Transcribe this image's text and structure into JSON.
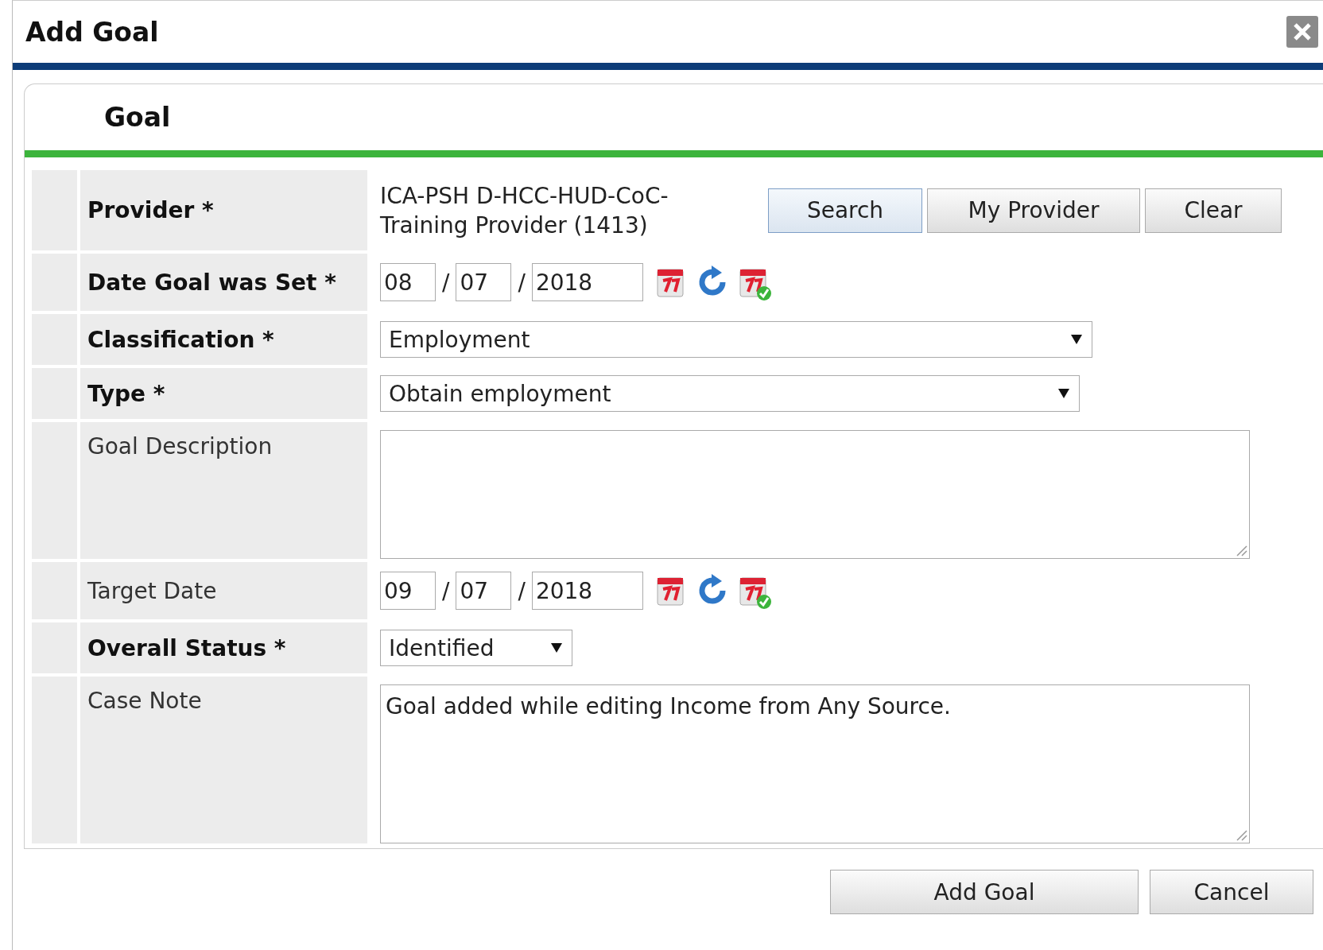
{
  "dialog": {
    "title": "Add Goal"
  },
  "section": {
    "title": "Goal"
  },
  "fields": [
    {
      "kind": "provider",
      "label": "Provider *",
      "required": true,
      "value": "ICA-PSH D-HCC-HUD-CoC-Training Provider (1413)",
      "buttons": [
        "Search",
        "My Provider",
        "Clear"
      ]
    },
    {
      "kind": "date",
      "label": "Date Goal was Set *",
      "required": true,
      "month": "08",
      "day": "07",
      "year": "2018",
      "separators": [
        "/",
        "/"
      ]
    },
    {
      "kind": "select",
      "label": "Classification *",
      "required": true,
      "value": "Employment"
    },
    {
      "kind": "select",
      "label": "Type *",
      "required": true,
      "value": "Obtain employment"
    },
    {
      "kind": "textarea",
      "label": "Goal Description",
      "required": false
    },
    {
      "kind": "date",
      "label": "Target Date",
      "required": false,
      "month": "09",
      "day": "07",
      "year": "2018",
      "separators": [
        "/",
        "/"
      ]
    },
    {
      "kind": "select",
      "label": "Overall Status *",
      "required": true,
      "value": "Identified"
    },
    {
      "kind": "textarea",
      "label": "Case Note",
      "required": false,
      "value": "Goal added while editing Income from Any Source."
    }
  ],
  "footer_buttons": [
    "Add Goal",
    "Cancel"
  ]
}
